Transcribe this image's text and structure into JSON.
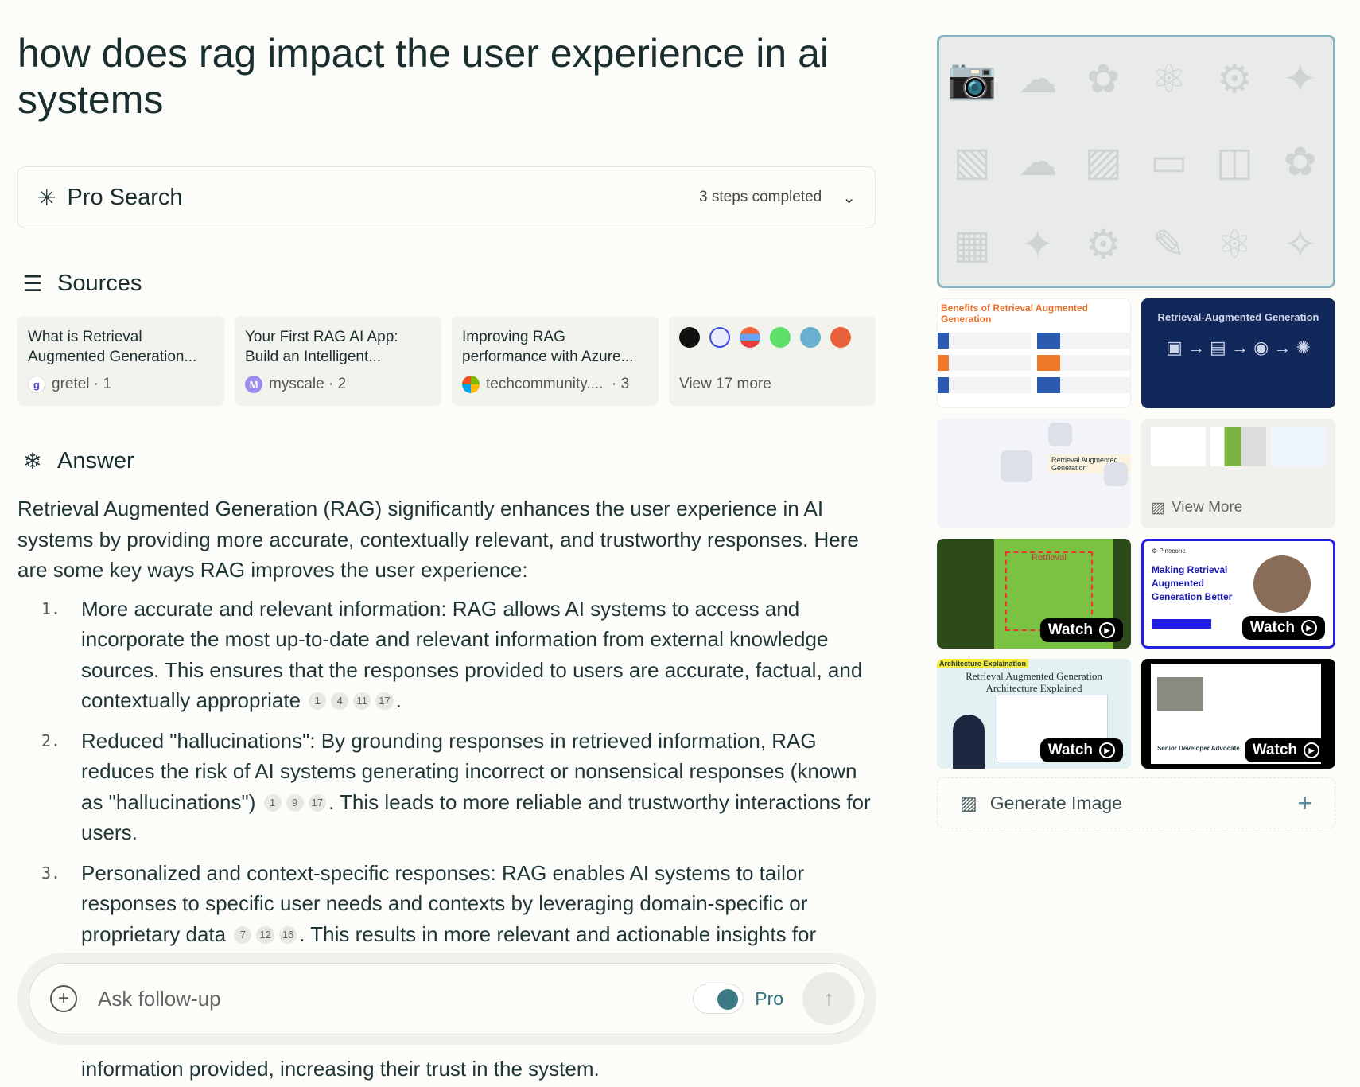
{
  "query": "how does rag impact the user experience in ai systems",
  "pro_search": {
    "label": "Pro Search",
    "status": "3 steps completed"
  },
  "sources": {
    "heading": "Sources",
    "items": [
      {
        "title": "What is Retrieval Augmented Generation...",
        "site": "gretel",
        "index": "1",
        "fav": "g",
        "color": "#4b3fe0"
      },
      {
        "title": "Your First RAG AI App: Build an Intelligent...",
        "site": "myscale",
        "index": "2",
        "fav": "M",
        "color": "#9b8cf0"
      },
      {
        "title": "Improving RAG performance with Azure...",
        "site": "techcommunity....",
        "index": "3",
        "fav": "",
        "color": "#f25022"
      }
    ],
    "more_label": "View 17 more",
    "more_icon_colors": [
      "#111111",
      "#3b4fe0",
      "#f0663c",
      "#5ce06a",
      "#6ab0d0",
      "#e8603c"
    ]
  },
  "answer": {
    "heading": "Answer",
    "intro": "Retrieval Augmented Generation (RAG) significantly enhances the user experience in AI systems by providing more accurate, contextually relevant, and trustworthy responses. Here are some key ways RAG improves the user experience:",
    "items": [
      {
        "n": "1.",
        "text": "More accurate and relevant information: RAG allows AI systems to access and incorporate the most up-to-date and relevant information from external knowledge sources. This ensures that the responses provided to users are accurate, factual, and contextually appropriate",
        "cites": [
          "1",
          "4",
          "11",
          "17"
        ],
        "after": "."
      },
      {
        "n": "2.",
        "text": "Reduced \"hallucinations\": By grounding responses in retrieved information, RAG reduces the risk of AI systems generating incorrect or nonsensical responses (known as \"hallucinations\")",
        "cites": [
          "1",
          "9",
          "17"
        ],
        "after": ". This leads to more reliable and trustworthy interactions for users."
      },
      {
        "n": "3.",
        "text": "Personalized and context-specific responses: RAG enables AI systems to tailor responses to specific user needs and contexts by leveraging domain-specific or proprietary data",
        "cites": [
          "7",
          "12",
          "16"
        ],
        "after": ". This results in more relevant and actionable insights for"
      }
    ],
    "tail": "information provided, increasing their trust in the system."
  },
  "followup": {
    "placeholder": "Ask follow-up",
    "pro_label": "Pro",
    "pro_enabled": true,
    "accent": "#3b7a85"
  },
  "media": {
    "view_more": "View More",
    "watch": "Watch",
    "generate": "Generate Image",
    "thumb_titles": [
      "Benefits of Retrieval Augmented Generation",
      "Retrieval-Augmented Generation",
      "Retrieval Augmented Generation",
      "Retrieval",
      "Making Retrieval Augmented Generation Better",
      "Retrieval Augmented Generation Architecture Explained",
      "Senior Developer Advocate"
    ]
  }
}
